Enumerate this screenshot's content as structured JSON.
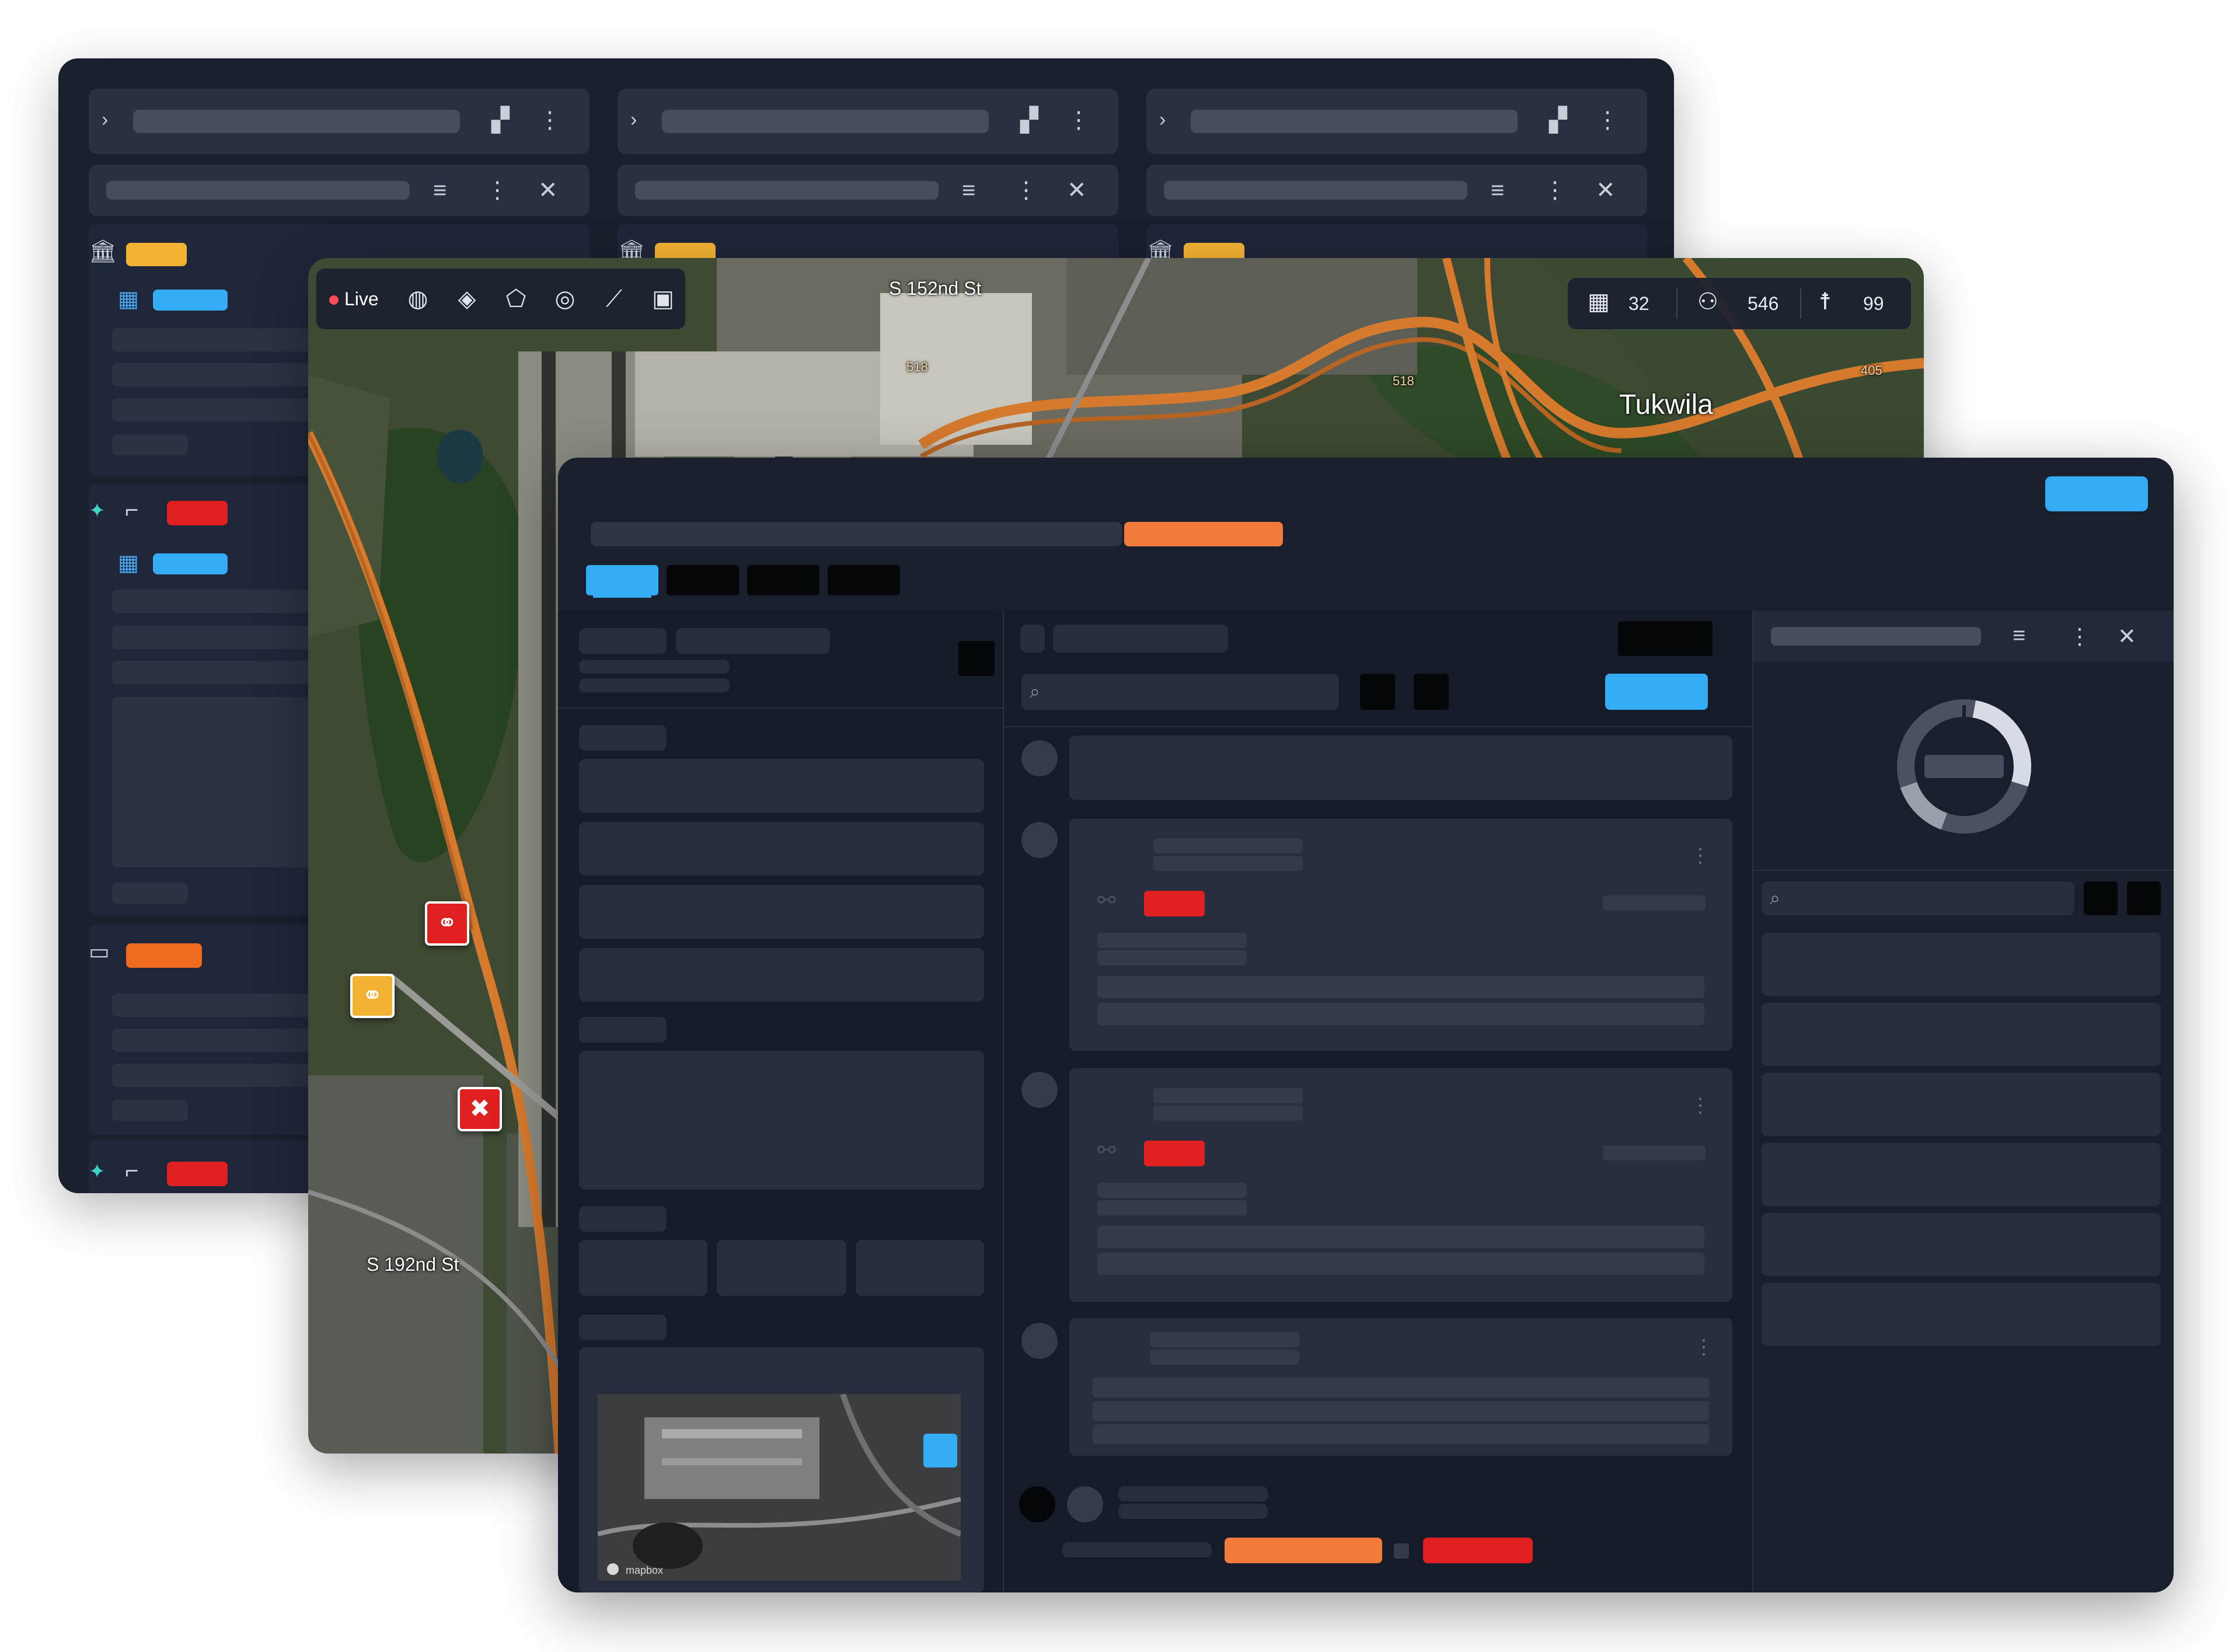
{
  "map": {
    "live_label": "Live",
    "stats": [
      {
        "icon": "building-icon",
        "value": "32"
      },
      {
        "icon": "people-icon",
        "value": "546"
      },
      {
        "icon": "person-walking-icon",
        "value": "99"
      }
    ],
    "street_labels": {
      "s152": "S 152nd St",
      "s192": "S 192nd St",
      "tukwila": "Tukwila",
      "r518a": "518",
      "r518b": "518",
      "r405": "405"
    }
  },
  "minimap": {
    "attribution": "mapbox"
  },
  "colors": {
    "window_bg": "#1a1f2e",
    "panel_bg": "#2a3040",
    "accent_blue": "#34abf5",
    "accent_orange": "#f17b3a",
    "alert_red": "#e02020",
    "warning_yellow": "#f2b233",
    "road_orange": "#d67a2e"
  },
  "icons": {
    "chevron": "chevron-right-icon",
    "add_panel": "add-panel-icon",
    "more": "more-vertical-icon",
    "filter": "filter-icon",
    "close": "close-icon",
    "search": "search-icon"
  }
}
